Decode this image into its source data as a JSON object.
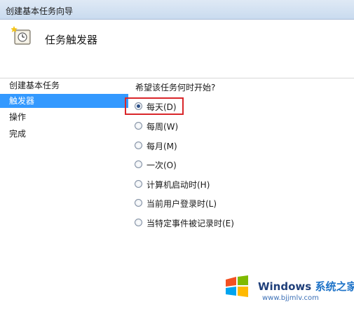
{
  "window": {
    "title": "创建基本任务向导"
  },
  "header": {
    "heading": "任务触发器"
  },
  "sidebar": {
    "items": [
      {
        "label": "创建基本任务",
        "active": false
      },
      {
        "label": "触发器",
        "active": true
      },
      {
        "label": "操作",
        "active": false
      },
      {
        "label": "完成",
        "active": false
      }
    ]
  },
  "main": {
    "question": "希望该任务何时开始?",
    "options": [
      {
        "label": "每天(D)",
        "checked": true
      },
      {
        "label": "每周(W)",
        "checked": false
      },
      {
        "label": "每月(M)",
        "checked": false
      },
      {
        "label": "一次(O)",
        "checked": false
      },
      {
        "label": "计算机启动时(H)",
        "checked": false
      },
      {
        "label": "当前用户登录时(L)",
        "checked": false
      },
      {
        "label": "当特定事件被记录时(E)",
        "checked": false
      }
    ]
  },
  "watermark": {
    "brand": "Windows",
    "site_cn": "系统之家",
    "url": "www.bjjmlv.com"
  },
  "colors": {
    "selection": "#3399ff",
    "highlight": "#d9262a"
  }
}
